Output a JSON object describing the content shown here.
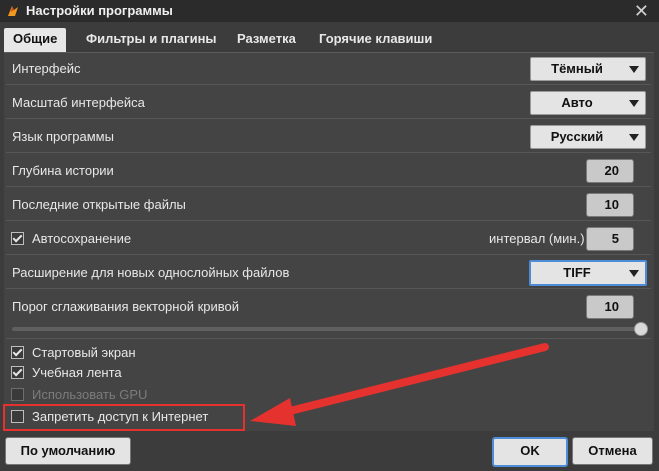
{
  "window": {
    "title": "Настройки программы",
    "close_glyph": "✕"
  },
  "tabs": [
    {
      "label": "Общие",
      "active": true
    },
    {
      "label": "Фильтры и плагины"
    },
    {
      "label": "Разметка"
    },
    {
      "label": "Горячие клавиши"
    }
  ],
  "settings": {
    "interface": {
      "label": "Интерфейс",
      "value": "Тёмный"
    },
    "scale": {
      "label": "Масштаб интерфейса",
      "value": "Авто"
    },
    "language": {
      "label": "Язык программы",
      "value": "Русский"
    },
    "history_depth": {
      "label": "Глубина истории",
      "value": "20"
    },
    "recent_files": {
      "label": "Последние открытые файлы",
      "value": "10"
    },
    "autosave": {
      "label": "Автосохранение",
      "checked": true,
      "interval_label": "интервал (мин.)",
      "interval_value": "5"
    },
    "extension": {
      "label": "Расширение для новых однослойных файлов",
      "value": "TIFF"
    },
    "smoothing": {
      "label": "Порог сглаживания векторной кривой",
      "value": "10",
      "slider_fraction": 1.0
    }
  },
  "checkboxes": {
    "start_screen": {
      "label": "Стартовый экран",
      "checked": true
    },
    "tutorial": {
      "label": "Учебная лента",
      "checked": true
    },
    "use_gpu": {
      "label": "Использовать GPU",
      "checked": false,
      "disabled": true
    },
    "block_internet": {
      "label": "Запретить доступ к Интернет",
      "checked": false
    }
  },
  "buttons": {
    "defaults": "По умолчанию",
    "ok": "OK",
    "cancel": "Отмена"
  },
  "colors": {
    "annotation": "#e5322e",
    "focus": "#4d8cd6"
  }
}
